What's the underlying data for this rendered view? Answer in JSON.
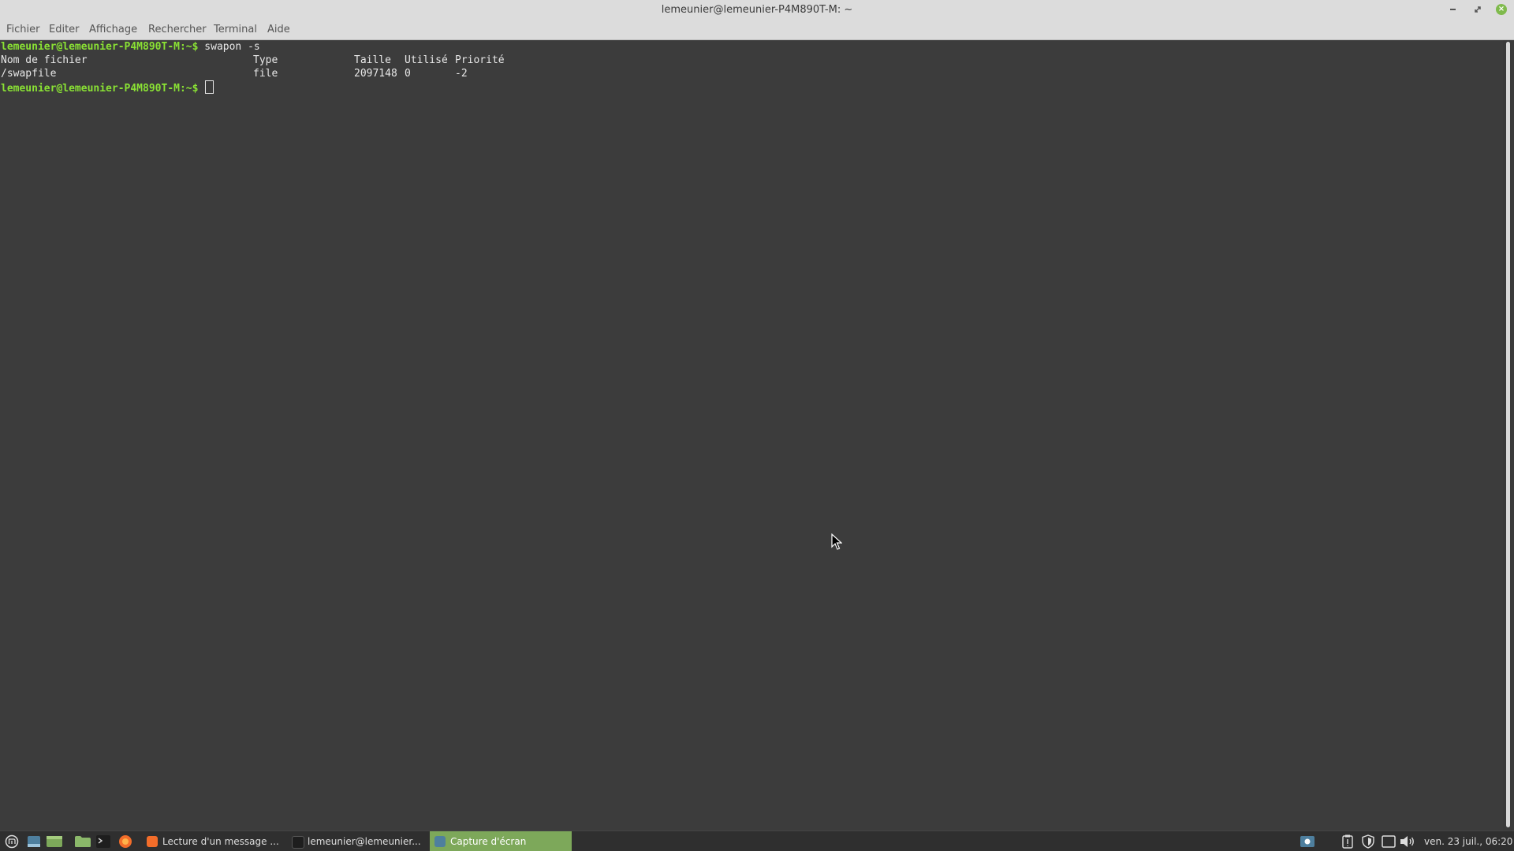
{
  "window": {
    "title": "lemeunier@lemeunier-P4M890T-M: ~",
    "buttons": {
      "minimize": "minimize-icon",
      "maximize": "maximize-icon",
      "close": "close-icon"
    }
  },
  "menubar": {
    "items": [
      "Fichier",
      "Editer",
      "Affichage",
      "Rechercher",
      "Terminal",
      "Aide"
    ]
  },
  "terminal": {
    "prompt": "lemeunier@lemeunier-P4M890T-M",
    "prompt_suffix": ":~$",
    "command": " swapon -s",
    "headers": [
      "Nom de fichier",
      "Type",
      "Taille",
      "Utilisé",
      "Priorité"
    ],
    "rows": [
      {
        "filename": "/swapfile",
        "type": "file",
        "size": "2097148",
        "used": "0",
        "priority": "-2"
      }
    ],
    "colors": {
      "prompt": "#8ae234",
      "text": "#e8e8e8",
      "background": "#3c3c3c"
    }
  },
  "taskbar": {
    "launchers": [
      "menu-icon",
      "show-desktop-icon",
      "workspace-icon",
      "files-icon",
      "terminal-icon",
      "firefox-icon"
    ],
    "tasks": [
      {
        "label": "Lecture d'un message ...",
        "icon": "browser-icon",
        "active": false
      },
      {
        "label": "lemeunier@lemeunier...",
        "icon": "terminal-icon",
        "active": false
      },
      {
        "label": "Capture d'écran",
        "icon": "screenshot-icon",
        "active": true
      }
    ],
    "tray": [
      "screenshot-tray-icon",
      "clipboard-icon",
      "shield-icon",
      "window-icon",
      "volume-icon"
    ],
    "clock": "ven. 23 juil., 06:20",
    "accent": "#7da85a"
  }
}
